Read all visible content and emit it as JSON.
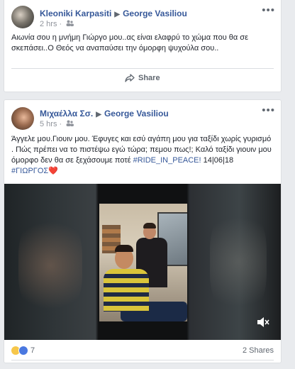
{
  "post1": {
    "author": "Kleoniki Karpasiti",
    "arrow": "▶",
    "target": "George Vasiliou",
    "time": "2 hrs",
    "privacy_icon": "friends-icon",
    "text": "Αιωνία σου η μνήμη Γιώργο μου..ας είναι ελαφρύ το χώμα που θα σε σκεπάσει..Ο Θεός να αναπαύσει την όμορφη ψυχούλα σου..",
    "more": "•••",
    "share_label": "Share"
  },
  "post2": {
    "author": "Μιχαέλλα Σσ.",
    "arrow": "▶",
    "target": "George Vasiliou",
    "time": "5 hrs",
    "privacy_icon": "friends-icon",
    "more": "•••",
    "text_main": "Άγγελε μου.Γιουιν μου. Έφυγες και εσύ αγάπη μου για ταξίδι χωρίς γυρισμό . Πώς πρέπει να το πιστέψω εγώ τώρα; πεμου πως!; Καλό ταξίδι γιουιν μου όμορφο δεν θα σε ξεχάσουμε ποτέ ",
    "hashtag1": "#RIDE_IN_PEACE!",
    "date": " 14|06|18",
    "hashtag2": "#ΓΙΩΡΓΟΣ",
    "heart": "❤️",
    "reaction_count": "7",
    "shares": "2 Shares",
    "video_mute_icon": "volume-muted-icon"
  },
  "colors": {
    "link": "#365899",
    "background": "#e9ebee",
    "heart": "#e0245e"
  }
}
